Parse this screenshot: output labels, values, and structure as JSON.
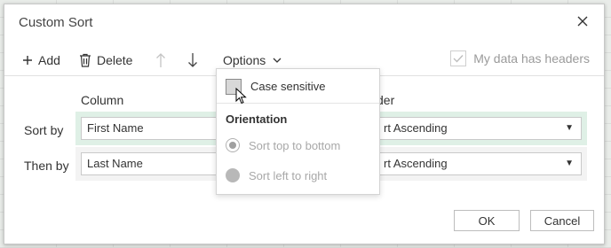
{
  "dialog": {
    "title": "Custom Sort",
    "close_icon": "close-icon"
  },
  "toolbar": {
    "add_label": "Add",
    "delete_label": "Delete",
    "options_label": "Options",
    "headers_label": "My data has headers",
    "headers_checked": true
  },
  "columns": {
    "column_header": "Column",
    "order_header": "der"
  },
  "rows": [
    {
      "label": "Sort by",
      "column": "First Name",
      "order": "rt Ascending",
      "selected": true
    },
    {
      "label": "Then by",
      "column": "Last Name",
      "order": "rt Ascending",
      "selected": false
    }
  ],
  "options_menu": {
    "case_sensitive_label": "Case sensitive",
    "orientation_heading": "Orientation",
    "sort_top_to_bottom_label": "Sort top to bottom",
    "sort_left_to_right_label": "Sort left to right"
  },
  "buttons": {
    "ok_label": "OK",
    "cancel_label": "Cancel"
  },
  "colors": {
    "selected_row": "#dff0e6",
    "unselected_row": "#f3f3f3",
    "disabled_text": "#a8a8a8"
  }
}
